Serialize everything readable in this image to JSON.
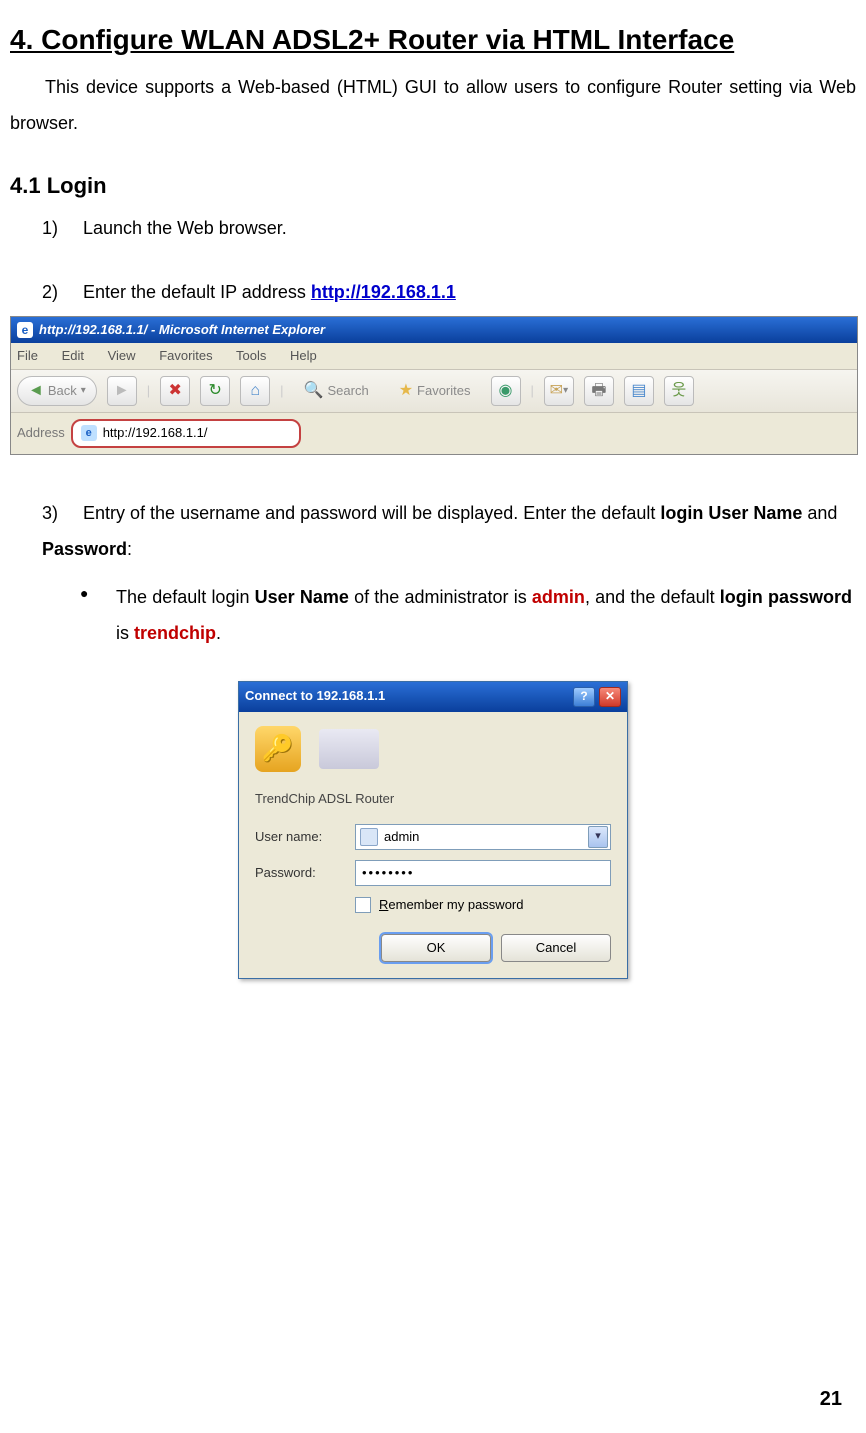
{
  "heading": "4. Configure WLAN ADSL2+ Router via HTML Interface",
  "intro": "This device supports a Web-based (HTML) GUI to allow users to configure Router setting via Web browser.",
  "subsection": "4.1 Login",
  "steps": {
    "s1": {
      "num": "1)",
      "text": "Launch the Web browser."
    },
    "s2": {
      "num": "2)",
      "text": "Enter the default IP address ",
      "link": "http://192.168.1.1"
    },
    "s3": {
      "num": "3)",
      "pre": "Entry of the username and password will be displayed. Enter the default ",
      "b1": "login User Name",
      "mid": " and ",
      "b2": "Password",
      "post": ":"
    },
    "bullet": {
      "p1": "The default login ",
      "b1": "User Name",
      "p2": " of the administrator is ",
      "v1": "admin",
      "p3": ", and the default ",
      "b2": "login password",
      "p4": " is ",
      "v2": "trendchip",
      "p5": "."
    }
  },
  "ie": {
    "title": "http://192.168.1.1/ - Microsoft Internet Explorer",
    "menu": [
      "File",
      "Edit",
      "View",
      "Favorites",
      "Tools",
      "Help"
    ],
    "back": "Back",
    "search": "Search",
    "favorites": "Favorites",
    "addressLabel": "Address",
    "addressValue": "http://192.168.1.1/"
  },
  "dialog": {
    "title": "Connect to 192.168.1.1",
    "realm": "TrendChip ADSL Router",
    "userLabel": "User name:",
    "userValue": "admin",
    "passLabel": "Password:",
    "passMasked": "••••••••",
    "remember": "Remember my password",
    "ok": "OK",
    "cancel": "Cancel"
  },
  "pageNumber": "21"
}
